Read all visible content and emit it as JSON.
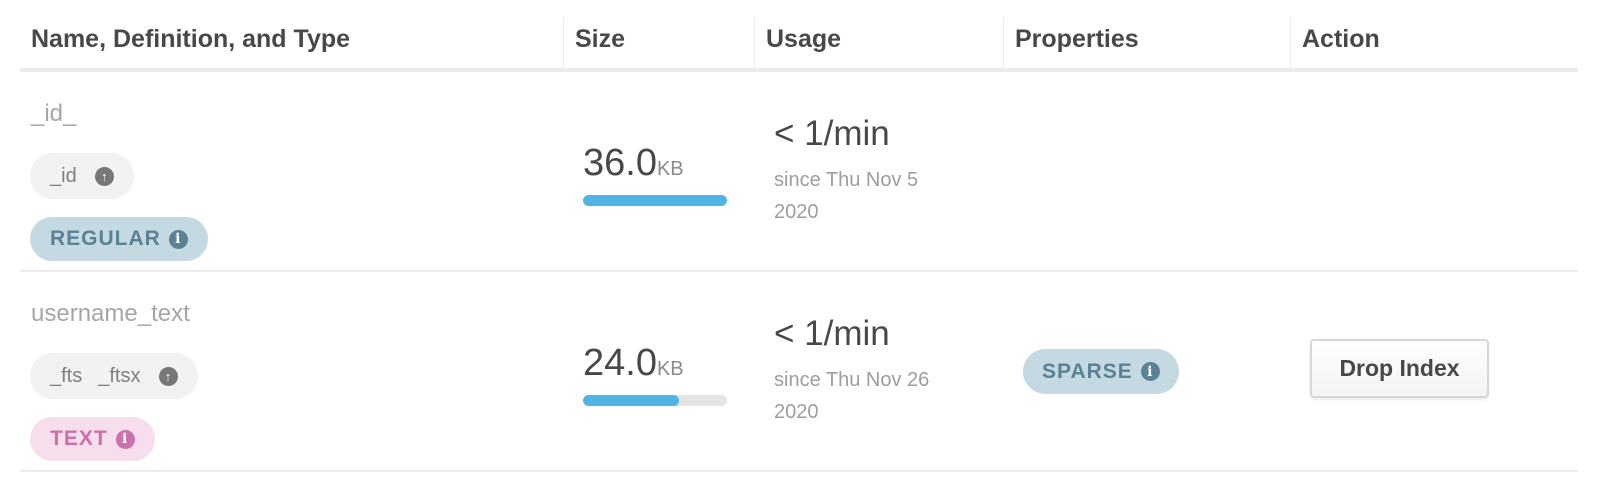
{
  "headers": {
    "name": "Name, Definition, and Type",
    "size": "Size",
    "usage": "Usage",
    "properties": "Properties",
    "action": "Action"
  },
  "rows": [
    {
      "name": "_id_",
      "fields": [
        "_id"
      ],
      "type": "REGULAR",
      "size_value": "36.0",
      "size_unit": "KB",
      "size_fraction": 1.0,
      "usage_rate": "< 1/min",
      "usage_since": "since Thu Nov 5 2020",
      "property": "",
      "action": ""
    },
    {
      "name": "username_text",
      "fields": [
        "_fts",
        "_ftsx"
      ],
      "type": "TEXT",
      "size_value": "24.0",
      "size_unit": "KB",
      "size_fraction": 0.667,
      "usage_rate": "< 1/min",
      "usage_since": "since Thu Nov 26 2020",
      "property": "SPARSE",
      "action": "Drop Index"
    }
  ],
  "colors": {
    "bar_fill": "#4fb3e3",
    "regular_badge": "#c5d9e3",
    "text_badge": "#f6deed"
  },
  "icons": {
    "sort_direction": "arrow-up-circle-icon",
    "info": "info-circle-icon"
  }
}
